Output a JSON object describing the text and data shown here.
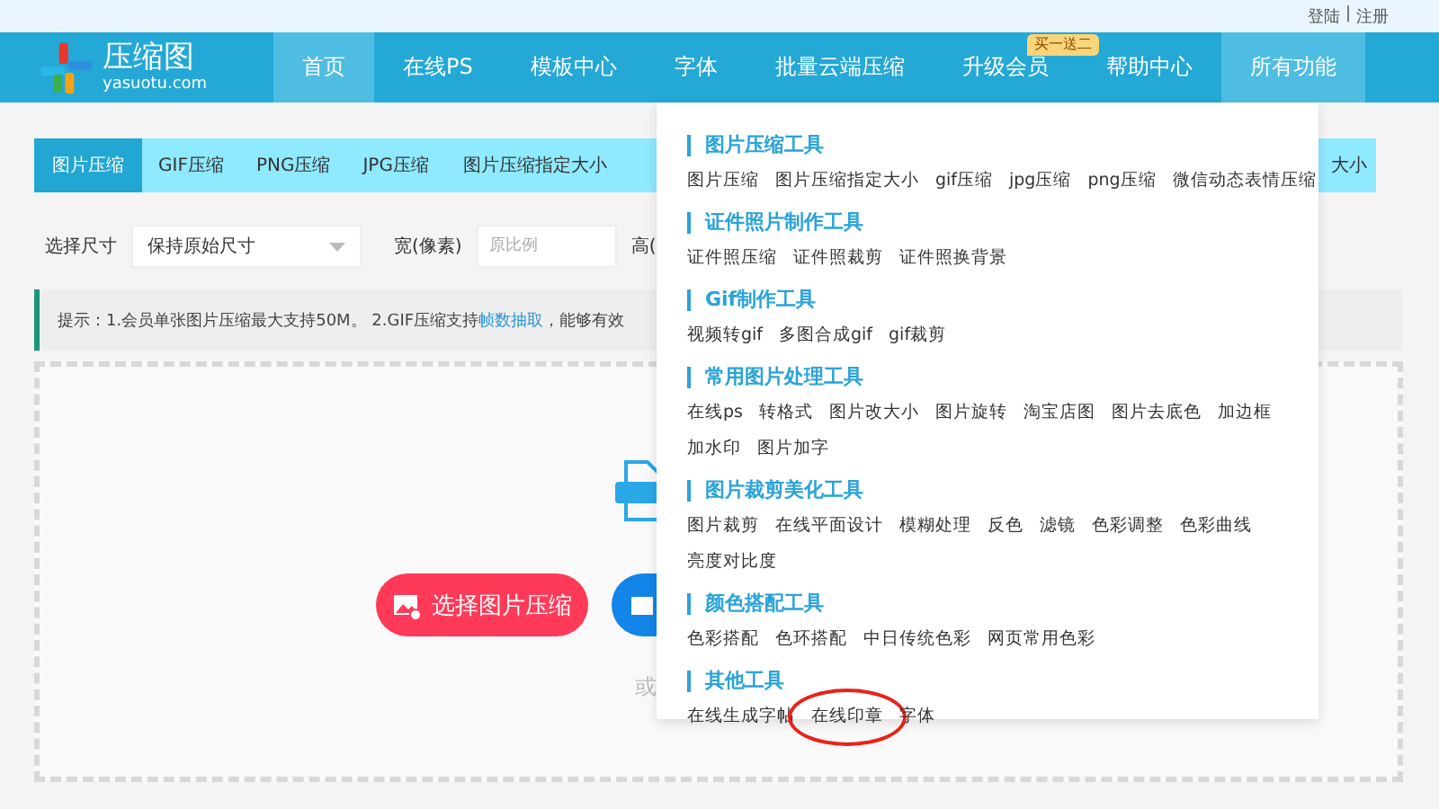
{
  "top_links": {
    "login": "登陆",
    "separator": "|",
    "register": "注册"
  },
  "logo": {
    "name": "压缩图",
    "domain": "yasuotu.com"
  },
  "nav": [
    {
      "label": "首页",
      "highlighted": true
    },
    {
      "label": "在线PS",
      "highlighted": false
    },
    {
      "label": "模板中心",
      "highlighted": false
    },
    {
      "label": "字体",
      "highlighted": false
    },
    {
      "label": "批量云端压缩",
      "highlighted": false
    },
    {
      "label": "升级会员",
      "highlighted": false,
      "badge": "买一送二"
    },
    {
      "label": "帮助中心",
      "highlighted": false
    },
    {
      "label": "所有功能",
      "highlighted": true
    }
  ],
  "tabs": [
    {
      "label": "图片压缩",
      "selected": true
    },
    {
      "label": "GIF压缩",
      "selected": false
    },
    {
      "label": "PNG压缩",
      "selected": false
    },
    {
      "label": "JPG压缩",
      "selected": false
    },
    {
      "label": "图片压缩指定大小",
      "selected": false
    },
    {
      "label": "大小",
      "selected": false
    }
  ],
  "form": {
    "size_label": "选择尺寸",
    "size_value": "保持原始尺寸",
    "width_label": "宽(像素)",
    "width_placeholder": "原比例",
    "height_label": "高("
  },
  "hint": {
    "before": "提示：1.会员单张图片压缩最大支持50M。 2.GIF压缩支持",
    "link": "帧数抽取",
    "after": "，能够有效"
  },
  "upload": {
    "select_button": "选择图片压缩",
    "or": "或"
  },
  "menu": {
    "sections": [
      {
        "title": "图片压缩工具",
        "rows": [
          [
            {
              "label": "图片压缩",
              "circled": false
            },
            {
              "label": "图片压缩指定大小",
              "circled": false
            },
            {
              "label": "gif压缩",
              "circled": false
            },
            {
              "label": "jpg压缩",
              "circled": false
            },
            {
              "label": "png压缩",
              "circled": false
            },
            {
              "label": "微信动态表情压缩",
              "circled": false
            }
          ]
        ]
      },
      {
        "title": "证件照片制作工具",
        "rows": [
          [
            {
              "label": "证件照压缩",
              "circled": false
            },
            {
              "label": "证件照裁剪",
              "circled": false
            },
            {
              "label": "证件照换背景",
              "circled": false
            }
          ]
        ]
      },
      {
        "title": "Gif制作工具",
        "rows": [
          [
            {
              "label": "视频转gif",
              "circled": false
            },
            {
              "label": "多图合成gif",
              "circled": false
            },
            {
              "label": "gif裁剪",
              "circled": false
            }
          ]
        ]
      },
      {
        "title": "常用图片处理工具",
        "rows": [
          [
            {
              "label": "在线ps",
              "circled": false
            },
            {
              "label": "转格式",
              "circled": false
            },
            {
              "label": "图片改大小",
              "circled": false
            },
            {
              "label": "图片旋转",
              "circled": false
            },
            {
              "label": "淘宝店图",
              "circled": false
            },
            {
              "label": "图片去底色",
              "circled": false
            },
            {
              "label": "加边框",
              "circled": false
            }
          ],
          [
            {
              "label": "加水印",
              "circled": false
            },
            {
              "label": "图片加字",
              "circled": false
            }
          ]
        ]
      },
      {
        "title": "图片裁剪美化工具",
        "rows": [
          [
            {
              "label": "图片裁剪",
              "circled": false
            },
            {
              "label": "在线平面设计",
              "circled": false
            },
            {
              "label": "模糊处理",
              "circled": false
            },
            {
              "label": "反色",
              "circled": false
            },
            {
              "label": "滤镜",
              "circled": false
            },
            {
              "label": "色彩调整",
              "circled": false
            },
            {
              "label": "色彩曲线",
              "circled": false
            }
          ],
          [
            {
              "label": "亮度对比度",
              "circled": false
            }
          ]
        ]
      },
      {
        "title": "颜色搭配工具",
        "rows": [
          [
            {
              "label": "色彩搭配",
              "circled": false
            },
            {
              "label": "色环搭配",
              "circled": false
            },
            {
              "label": "中日传统色彩",
              "circled": false
            },
            {
              "label": "网页常用色彩",
              "circled": false
            }
          ]
        ]
      },
      {
        "title": "其他工具",
        "rows": [
          [
            {
              "label": "在线生成字帖",
              "circled": false
            },
            {
              "label": "在线印章",
              "circled": true
            },
            {
              "label": "字体",
              "circled": false
            }
          ]
        ]
      }
    ]
  }
}
